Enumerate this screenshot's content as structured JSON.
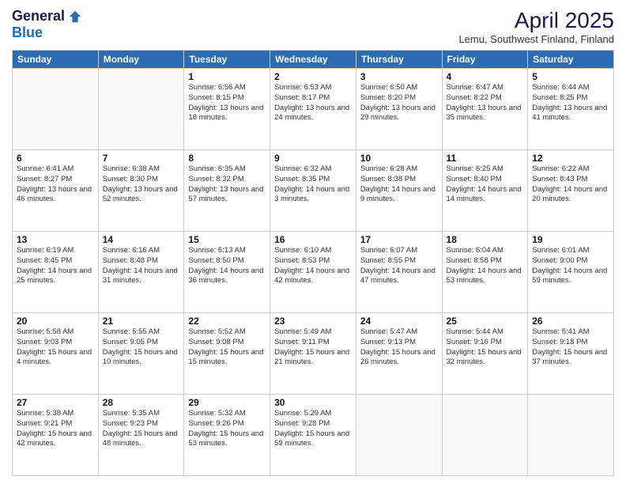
{
  "logo": {
    "general": "General",
    "blue": "Blue"
  },
  "header": {
    "month": "April 2025",
    "location": "Lemu, Southwest Finland, Finland"
  },
  "days_of_week": [
    "Sunday",
    "Monday",
    "Tuesday",
    "Wednesday",
    "Thursday",
    "Friday",
    "Saturday"
  ],
  "weeks": [
    [
      {
        "day": "",
        "info": ""
      },
      {
        "day": "",
        "info": ""
      },
      {
        "day": "1",
        "info": "Sunrise: 6:56 AM\nSunset: 8:15 PM\nDaylight: 13 hours and 18 minutes."
      },
      {
        "day": "2",
        "info": "Sunrise: 6:53 AM\nSunset: 8:17 PM\nDaylight: 13 hours and 24 minutes."
      },
      {
        "day": "3",
        "info": "Sunrise: 6:50 AM\nSunset: 8:20 PM\nDaylight: 13 hours and 29 minutes."
      },
      {
        "day": "4",
        "info": "Sunrise: 6:47 AM\nSunset: 8:22 PM\nDaylight: 13 hours and 35 minutes."
      },
      {
        "day": "5",
        "info": "Sunrise: 6:44 AM\nSunset: 8:25 PM\nDaylight: 13 hours and 41 minutes."
      }
    ],
    [
      {
        "day": "6",
        "info": "Sunrise: 6:41 AM\nSunset: 8:27 PM\nDaylight: 13 hours and 46 minutes."
      },
      {
        "day": "7",
        "info": "Sunrise: 6:38 AM\nSunset: 8:30 PM\nDaylight: 13 hours and 52 minutes."
      },
      {
        "day": "8",
        "info": "Sunrise: 6:35 AM\nSunset: 8:32 PM\nDaylight: 13 hours and 57 minutes."
      },
      {
        "day": "9",
        "info": "Sunrise: 6:32 AM\nSunset: 8:35 PM\nDaylight: 14 hours and 3 minutes."
      },
      {
        "day": "10",
        "info": "Sunrise: 6:28 AM\nSunset: 8:38 PM\nDaylight: 14 hours and 9 minutes."
      },
      {
        "day": "11",
        "info": "Sunrise: 6:25 AM\nSunset: 8:40 PM\nDaylight: 14 hours and 14 minutes."
      },
      {
        "day": "12",
        "info": "Sunrise: 6:22 AM\nSunset: 8:43 PM\nDaylight: 14 hours and 20 minutes."
      }
    ],
    [
      {
        "day": "13",
        "info": "Sunrise: 6:19 AM\nSunset: 8:45 PM\nDaylight: 14 hours and 25 minutes."
      },
      {
        "day": "14",
        "info": "Sunrise: 6:16 AM\nSunset: 8:48 PM\nDaylight: 14 hours and 31 minutes."
      },
      {
        "day": "15",
        "info": "Sunrise: 6:13 AM\nSunset: 8:50 PM\nDaylight: 14 hours and 36 minutes."
      },
      {
        "day": "16",
        "info": "Sunrise: 6:10 AM\nSunset: 8:53 PM\nDaylight: 14 hours and 42 minutes."
      },
      {
        "day": "17",
        "info": "Sunrise: 6:07 AM\nSunset: 8:55 PM\nDaylight: 14 hours and 47 minutes."
      },
      {
        "day": "18",
        "info": "Sunrise: 6:04 AM\nSunset: 8:58 PM\nDaylight: 14 hours and 53 minutes."
      },
      {
        "day": "19",
        "info": "Sunrise: 6:01 AM\nSunset: 9:00 PM\nDaylight: 14 hours and 59 minutes."
      }
    ],
    [
      {
        "day": "20",
        "info": "Sunrise: 5:58 AM\nSunset: 9:03 PM\nDaylight: 15 hours and 4 minutes."
      },
      {
        "day": "21",
        "info": "Sunrise: 5:55 AM\nSunset: 9:05 PM\nDaylight: 15 hours and 10 minutes."
      },
      {
        "day": "22",
        "info": "Sunrise: 5:52 AM\nSunset: 9:08 PM\nDaylight: 15 hours and 15 minutes."
      },
      {
        "day": "23",
        "info": "Sunrise: 5:49 AM\nSunset: 9:11 PM\nDaylight: 15 hours and 21 minutes."
      },
      {
        "day": "24",
        "info": "Sunrise: 5:47 AM\nSunset: 9:13 PM\nDaylight: 15 hours and 26 minutes."
      },
      {
        "day": "25",
        "info": "Sunrise: 5:44 AM\nSunset: 9:16 PM\nDaylight: 15 hours and 32 minutes."
      },
      {
        "day": "26",
        "info": "Sunrise: 5:41 AM\nSunset: 9:18 PM\nDaylight: 15 hours and 37 minutes."
      }
    ],
    [
      {
        "day": "27",
        "info": "Sunrise: 5:38 AM\nSunset: 9:21 PM\nDaylight: 15 hours and 42 minutes."
      },
      {
        "day": "28",
        "info": "Sunrise: 5:35 AM\nSunset: 9:23 PM\nDaylight: 15 hours and 48 minutes."
      },
      {
        "day": "29",
        "info": "Sunrise: 5:32 AM\nSunset: 9:26 PM\nDaylight: 15 hours and 53 minutes."
      },
      {
        "day": "30",
        "info": "Sunrise: 5:29 AM\nSunset: 9:28 PM\nDaylight: 15 hours and 59 minutes."
      },
      {
        "day": "",
        "info": ""
      },
      {
        "day": "",
        "info": ""
      },
      {
        "day": "",
        "info": ""
      }
    ]
  ]
}
